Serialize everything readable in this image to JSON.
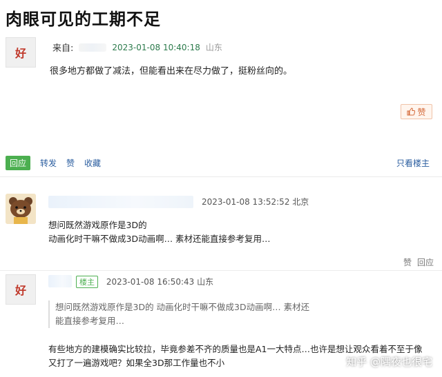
{
  "title": "肉眼可见的工期不足",
  "post": {
    "avatar_char": "好",
    "from_label": "来自:",
    "date": "2023-01-08 10:40:18",
    "location": "山东",
    "text": "很多地方都做了减法，但能看出来在尽力做了，挺粉丝向的。",
    "like_label": "赞"
  },
  "actions": {
    "reply": "回应",
    "forward": "转发",
    "like": "赞",
    "collect": "收藏",
    "only_op": "只看楼主"
  },
  "replies": [
    {
      "date": "2023-01-08 13:52:52",
      "location": "北京",
      "line1": "想问既然游戏原作是3D的",
      "line2": "动画化时干嘛不做成3D动画啊… 素材还能直接参考复用…",
      "like": "赞",
      "reply": "回应"
    },
    {
      "avatar_char": "好",
      "badge": "楼主",
      "date": "2023-01-08 16:50:43",
      "location": "山东",
      "quote_line1": "想问既然游戏原作是3D的 动画化时干嘛不做成3D动画啊… 素材还",
      "quote_line2": "能直接参考复用…",
      "line1": "有些地方的建模确实比较拉，毕竟参差不齐的质量也是A1一大特点…也许是想让观众看着不至于像",
      "line2": "又打了一遍游戏吧？如果全3D那工作量也不小"
    }
  ],
  "watermark": "知乎 @隅夜也很宅"
}
